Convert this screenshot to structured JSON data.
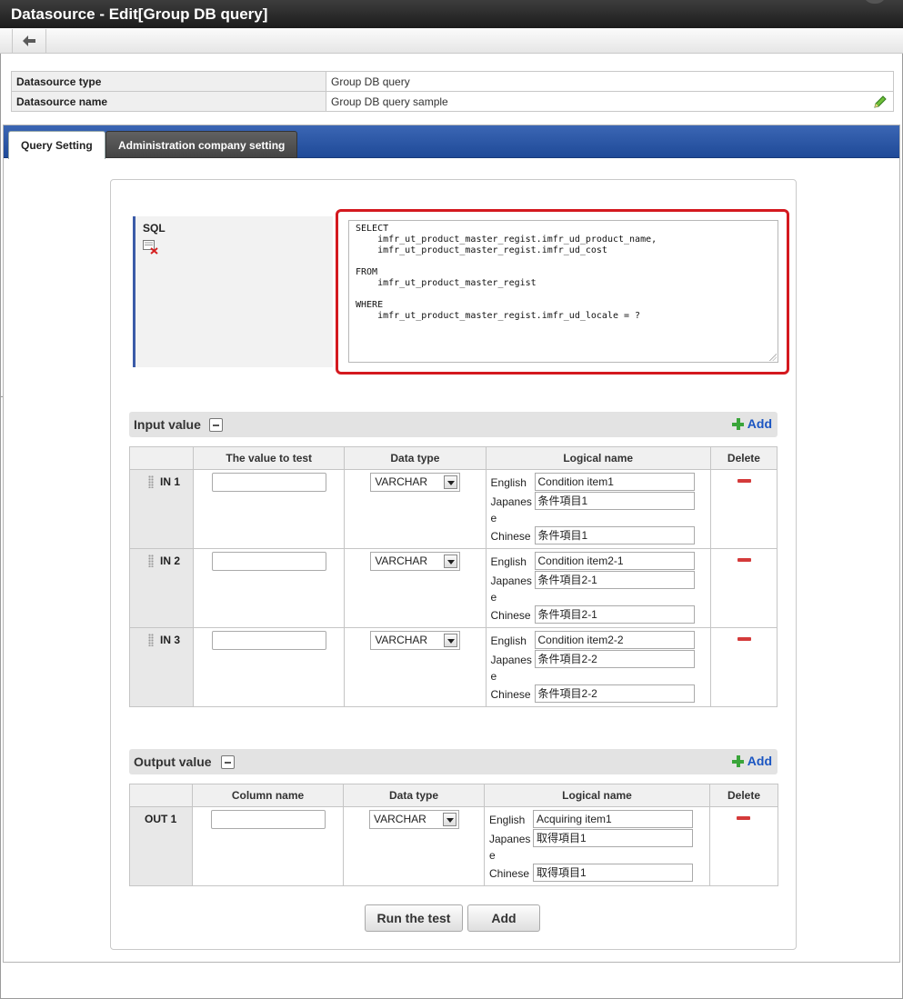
{
  "window": {
    "title": "Datasource - Edit[Group DB query]"
  },
  "toolbar": {
    "back_icon": "arrow-left-icon"
  },
  "info": {
    "type_label": "Datasource type",
    "type_value": "Group DB query",
    "name_label": "Datasource name",
    "name_value": "Group DB query sample"
  },
  "tabs": [
    {
      "label": "Query Setting",
      "active": true
    },
    {
      "label": "Administration company setting",
      "active": false
    }
  ],
  "sql": {
    "label": "SQL",
    "text": "SELECT\n    imfr_ut_product_master_regist.imfr_ud_product_name,\n    imfr_ut_product_master_regist.imfr_ud_cost\n\nFROM\n    imfr_ut_product_master_regist\n\nWHERE\n    imfr_ut_product_master_regist.imfr_ud_locale = ?"
  },
  "input_section": {
    "title": "Input value",
    "add_label": "Add",
    "headers": [
      "The value to test",
      "Data type",
      "Logical name",
      "Delete"
    ],
    "rows": [
      {
        "id": "IN 1",
        "test_value": "",
        "data_type": "VARCHAR",
        "english": "Condition item1",
        "japanese": "条件項目1",
        "chinese": "条件項目1"
      },
      {
        "id": "IN 2",
        "test_value": "",
        "data_type": "VARCHAR",
        "english": "Condition item2-1",
        "japanese": "条件項目2-1",
        "chinese": "条件項目2-1"
      },
      {
        "id": "IN 3",
        "test_value": "",
        "data_type": "VARCHAR",
        "english": "Condition item2-2",
        "japanese": "条件項目2-2",
        "chinese": "条件項目2-2"
      }
    ]
  },
  "output_section": {
    "title": "Output value",
    "add_label": "Add",
    "headers": [
      "Column name",
      "Data type",
      "Logical name",
      "Delete"
    ],
    "rows": [
      {
        "id": "OUT 1",
        "column_name": "",
        "data_type": "VARCHAR",
        "english": "Acquiring item1",
        "japanese": "取得項目1",
        "chinese": "取得項目1"
      }
    ]
  },
  "lang_labels": {
    "english": "English",
    "japanese_1": "Japanes",
    "japanese_2": "e",
    "chinese": "Chinese"
  },
  "buttons": {
    "run_test": "Run the test",
    "add": "Add"
  },
  "colors": {
    "title_bar": "#2b2b2b",
    "tab_bar": "#2c57a6",
    "highlight_border": "#d4191f",
    "add_link": "#1a55c2",
    "delete": "#d43a3a"
  }
}
